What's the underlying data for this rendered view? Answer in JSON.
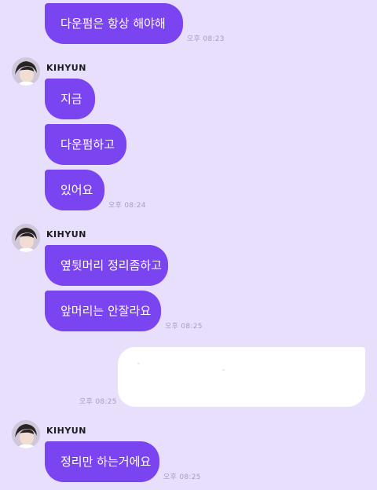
{
  "sender_name": "KIHYUN",
  "messages": [
    {
      "text": "다운펌은 항상 해야해",
      "time": "오후 08:23"
    },
    {
      "text": "지금"
    },
    {
      "text": "다운펌하고"
    },
    {
      "text": "있어요",
      "time": "오후 08:24"
    },
    {
      "text": "옆뒷머리 정리좀하고"
    },
    {
      "text": "앞머리는 안잘라요",
      "time": "오후 08:25"
    },
    {
      "text": "정리만 하는거에요",
      "time": "오후 08:25"
    }
  ],
  "my_message": {
    "text": "",
    "time": "오후 08:25"
  },
  "colors": {
    "background": "#e7dffb",
    "bubble": "#7a44f0",
    "my_bubble": "#ffffff",
    "timestamp": "#a99bc4"
  }
}
